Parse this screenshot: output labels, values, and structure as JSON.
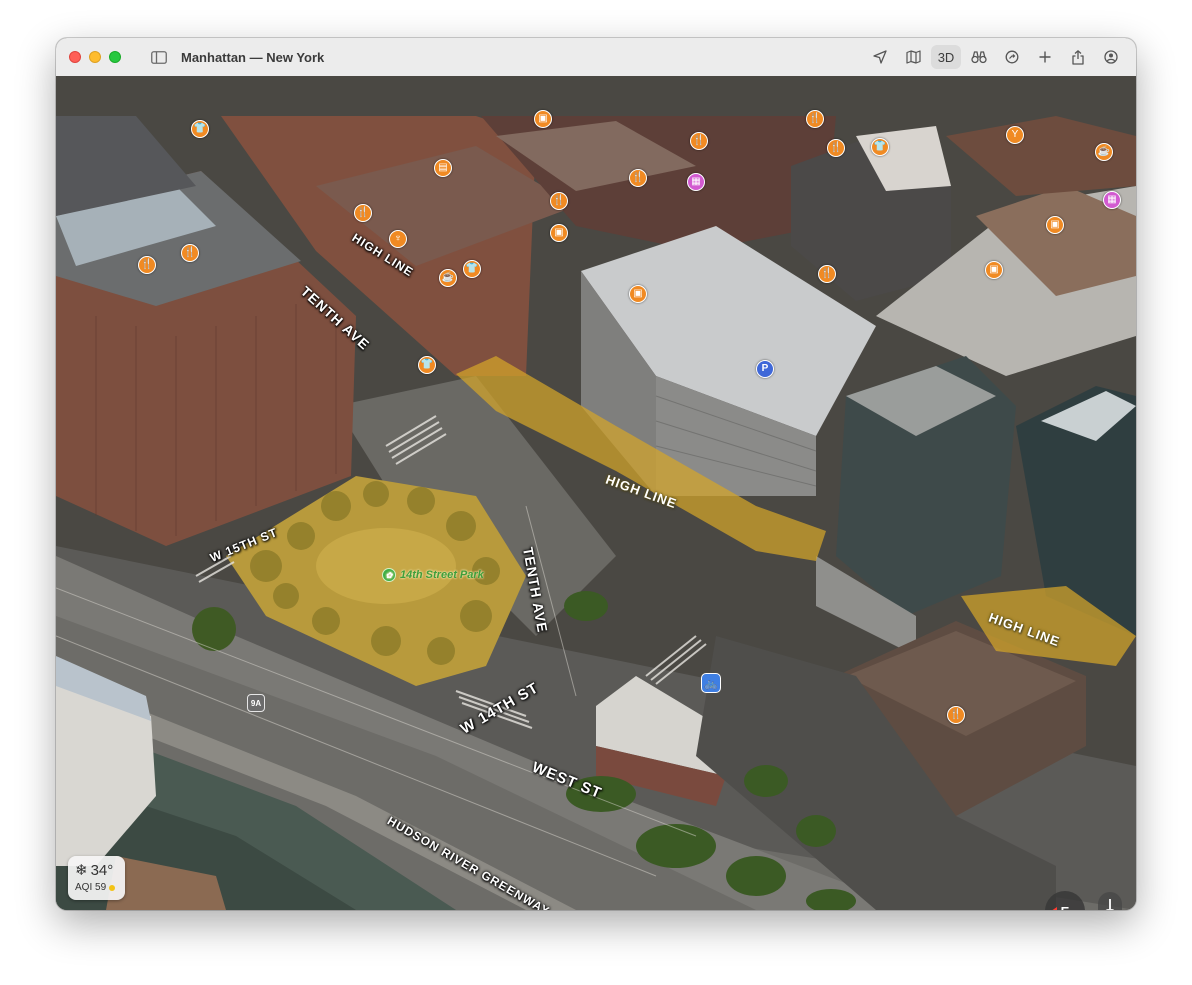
{
  "window": {
    "title": "Manhattan — New York"
  },
  "toolbar": {
    "items": [
      {
        "name": "location-arrow-icon"
      },
      {
        "name": "map-mode-icon"
      },
      {
        "name": "3d-toggle",
        "label": "3D"
      },
      {
        "name": "binoculars-icon"
      },
      {
        "name": "recents-icon"
      },
      {
        "name": "add-icon"
      },
      {
        "name": "share-icon"
      },
      {
        "name": "account-icon"
      }
    ]
  },
  "map": {
    "road_labels": {
      "tenth_ave_north": "TENTH AVE",
      "high_line_top": "HIGH LINE",
      "w_15th_st": "W 15TH ST",
      "tenth_ave_south": "TENTH AVE",
      "w_14th_st": "W 14TH ST",
      "west_st": "WEST ST",
      "hudson_river_greenway": "HUDSON RIVER GREENWAY"
    },
    "high_line_labels": {
      "center": "HIGH LINE",
      "right": "HIGH LINE"
    },
    "park": {
      "name": "14th Street Park"
    },
    "route_shield": "9A",
    "colors": {
      "poi_orange": "#f08a23",
      "poi_pink": "#d25ad0",
      "parking_blue": "#3f68d8",
      "high_line_overlay": "#d4a52a",
      "park_green": "#3fae44"
    },
    "poi_markers": [
      {
        "id": "clothing-1",
        "icon": "tshirt-icon",
        "color": "orange",
        "glyph": "👕"
      },
      {
        "id": "shop-1",
        "icon": "bag-icon",
        "color": "orange",
        "glyph": "▣"
      },
      {
        "id": "restaurant-1",
        "icon": "fork-knife-icon",
        "color": "orange",
        "glyph": "🍴"
      },
      {
        "id": "restaurant-2",
        "icon": "fork-knife-icon",
        "color": "orange",
        "glyph": "🍴"
      },
      {
        "id": "restaurant-3",
        "icon": "fork-knife-icon",
        "color": "orange",
        "glyph": "🍴"
      },
      {
        "id": "bar-1",
        "icon": "cocktail-icon",
        "color": "orange",
        "glyph": "Y"
      },
      {
        "id": "cafe-1",
        "icon": "cup-icon",
        "color": "orange",
        "glyph": "☕"
      },
      {
        "id": "books-1",
        "icon": "book-icon",
        "color": "orange",
        "glyph": "▤"
      },
      {
        "id": "restaurant-4",
        "icon": "fork-knife-icon",
        "color": "orange",
        "glyph": "🍴"
      },
      {
        "id": "restaurant-5",
        "icon": "fork-knife-icon",
        "color": "orange",
        "glyph": "🍴"
      },
      {
        "id": "transit-1",
        "icon": "theater-icon",
        "color": "pink",
        "glyph": "▦"
      },
      {
        "id": "restaurant-6",
        "icon": "fork-knife-icon",
        "color": "orange",
        "glyph": "🍴"
      },
      {
        "id": "clothing-2",
        "icon": "tshirt-icon",
        "color": "orange",
        "glyph": "👕"
      },
      {
        "id": "restaurant-7",
        "icon": "fork-knife-icon",
        "color": "orange",
        "glyph": "🍴"
      },
      {
        "id": "shop-2",
        "icon": "bag-icon",
        "color": "orange",
        "glyph": "▣"
      },
      {
        "id": "restaurant-8",
        "icon": "fork-knife-icon",
        "color": "orange",
        "glyph": "🍴"
      },
      {
        "id": "restaurant-9",
        "icon": "fork-knife-icon",
        "color": "orange",
        "glyph": "🍴"
      },
      {
        "id": "dessert-1",
        "icon": "dessert-icon",
        "color": "orange",
        "glyph": "♆"
      },
      {
        "id": "cafe-2",
        "icon": "cup-icon",
        "color": "orange",
        "glyph": "☕"
      },
      {
        "id": "clothing-3",
        "icon": "tshirt-icon",
        "color": "orange",
        "glyph": "👕"
      },
      {
        "id": "shop-3",
        "icon": "bag-icon",
        "color": "orange",
        "glyph": "▣"
      },
      {
        "id": "shop-4",
        "icon": "bag-icon",
        "color": "orange",
        "glyph": "▣"
      },
      {
        "id": "restaurant-10",
        "icon": "fork-knife-icon",
        "color": "orange",
        "glyph": "🍴"
      },
      {
        "id": "shop-5",
        "icon": "bag-icon",
        "color": "orange",
        "glyph": "▣"
      },
      {
        "id": "shop-6",
        "icon": "bag-icon",
        "color": "orange",
        "glyph": "▣"
      },
      {
        "id": "transit-2",
        "icon": "theater-icon",
        "color": "pink",
        "glyph": "▦"
      },
      {
        "id": "cafe-3",
        "icon": "cup-icon",
        "color": "orange",
        "glyph": "☕"
      },
      {
        "id": "clothing-4",
        "icon": "tshirt-icon",
        "color": "orange",
        "glyph": "👕"
      },
      {
        "id": "parking-1",
        "icon": "parking-icon",
        "color": "blue",
        "glyph": "P"
      },
      {
        "id": "restaurant-11",
        "icon": "fork-knife-icon",
        "color": "orange",
        "glyph": "🍴"
      }
    ],
    "bike_marker": {
      "icon": "bicycle-icon",
      "glyph": "🚲"
    }
  },
  "weather": {
    "temperature": "34°",
    "aqi": "AQI 59",
    "icon": "snowflake-icon"
  },
  "controls": {
    "zoom_out": "−",
    "zoom_in": "+",
    "compass_heading": "E"
  }
}
